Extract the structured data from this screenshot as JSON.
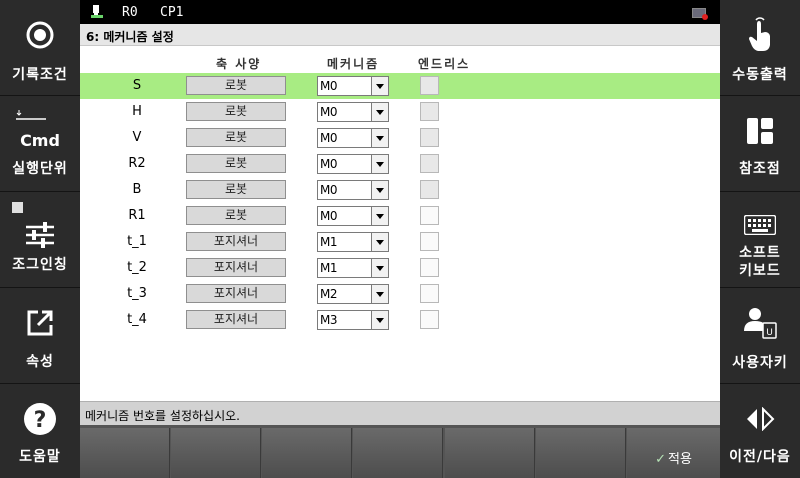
{
  "status": {
    "robot": "R0",
    "cp": "CP1"
  },
  "title": "6: 메커니즘 설정",
  "columns": {
    "spec": "축 사양",
    "mechanism": "메커니즘",
    "endless": "엔드리스"
  },
  "rows": [
    {
      "axis": "S",
      "spec": "로봇",
      "mechanism": "M0",
      "selected": true,
      "endless": false
    },
    {
      "axis": "H",
      "spec": "로봇",
      "mechanism": "M0",
      "selected": false,
      "endless": false
    },
    {
      "axis": "V",
      "spec": "로봇",
      "mechanism": "M0",
      "selected": false,
      "endless": false
    },
    {
      "axis": "R2",
      "spec": "로봇",
      "mechanism": "M0",
      "selected": false,
      "endless": false
    },
    {
      "axis": "B",
      "spec": "로봇",
      "mechanism": "M0",
      "selected": false,
      "endless": false
    },
    {
      "axis": "R1",
      "spec": "로봇",
      "mechanism": "M0",
      "selected": false,
      "endless": false
    },
    {
      "axis": "t_1",
      "spec": "포지셔너",
      "mechanism": "M1",
      "selected": false,
      "endless": false
    },
    {
      "axis": "t_2",
      "spec": "포지셔너",
      "mechanism": "M1",
      "selected": false,
      "endless": false
    },
    {
      "axis": "t_3",
      "spec": "포지셔너",
      "mechanism": "M2",
      "selected": false,
      "endless": false
    },
    {
      "axis": "t_4",
      "spec": "포지셔너",
      "mechanism": "M3",
      "selected": false,
      "endless": false
    }
  ],
  "message": "메커니즘 번호를 설정하십시오.",
  "left_menu": {
    "record_condition": "기록조건",
    "cmd": "Cmd",
    "exec_unit": "실행단위",
    "jogging": "조그인칭",
    "property": "속성",
    "help": "도움말"
  },
  "right_menu": {
    "manual_output": "수동출력",
    "reference": "참조점",
    "soft_keyboard": "소프트\n키보드",
    "soft_keyboard_line1": "소프트",
    "soft_keyboard_line2": "키보드",
    "user_key": "사용자키",
    "prev_next": "이전/다음"
  },
  "fkeys": [
    "",
    "",
    "",
    "",
    "",
    "",
    "적용"
  ],
  "colors": {
    "selected_row": "#a8ec83",
    "panel": "#2b2b2b"
  }
}
